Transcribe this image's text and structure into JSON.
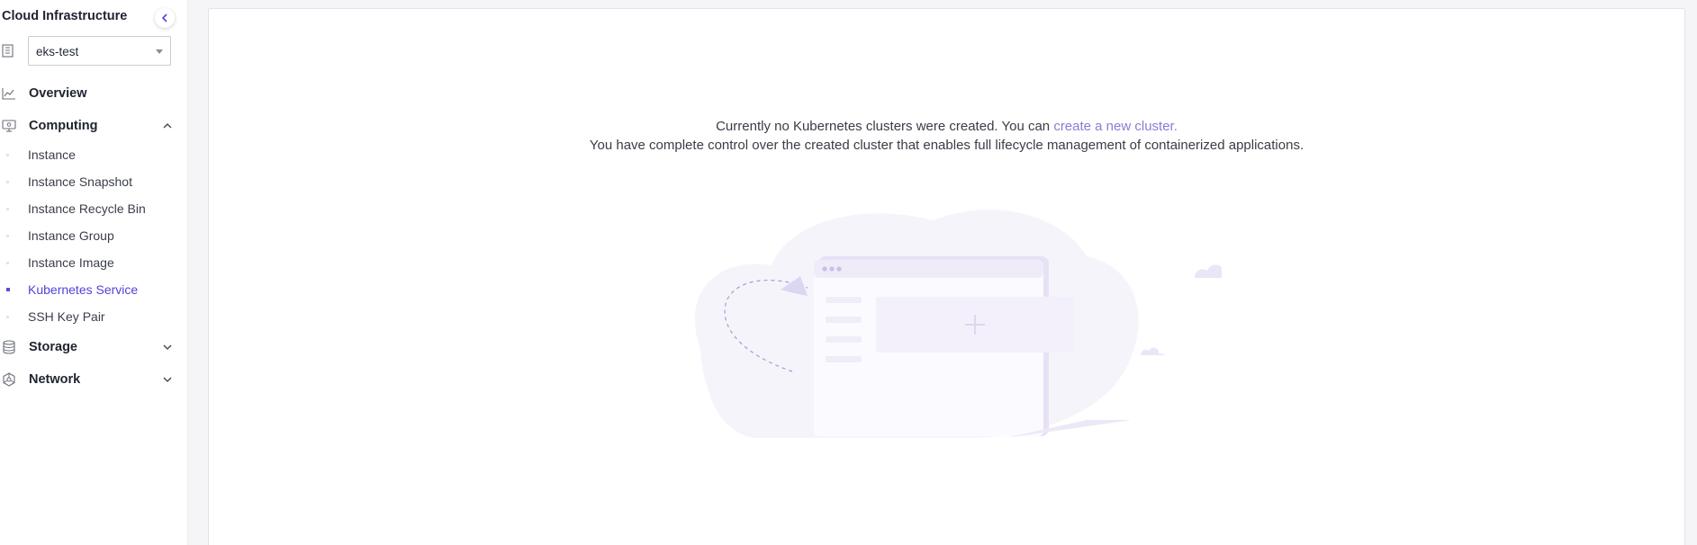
{
  "sidebar": {
    "title": "Cloud Infrastructure",
    "region": {
      "value": "eks-test"
    },
    "overview": {
      "label": "Overview"
    },
    "computing": {
      "label": "Computing",
      "items": [
        {
          "label": "Instance"
        },
        {
          "label": "Instance Snapshot"
        },
        {
          "label": "Instance Recycle Bin"
        },
        {
          "label": "Instance Group"
        },
        {
          "label": "Instance Image"
        },
        {
          "label": "Kubernetes Service",
          "active": true
        },
        {
          "label": "SSH Key Pair"
        }
      ]
    },
    "storage": {
      "label": "Storage"
    },
    "network": {
      "label": "Network"
    }
  },
  "main": {
    "empty_line1_prefix": "Currently no Kubernetes clusters were created. You can ",
    "empty_line1_link": "create a new cluster.",
    "empty_line2": "You have complete control over the created cluster that enables full lifecycle management of containerized applications."
  },
  "colors": {
    "accent": "#5343d6",
    "link": "#8d7bd4",
    "illustration": "#f3f1fa"
  },
  "icons": {
    "collapse": "chevron-left-icon",
    "region": "building-icon",
    "overview": "chart-line-icon",
    "computing": "monitor-icon",
    "storage": "database-icon",
    "network": "network-icon"
  }
}
